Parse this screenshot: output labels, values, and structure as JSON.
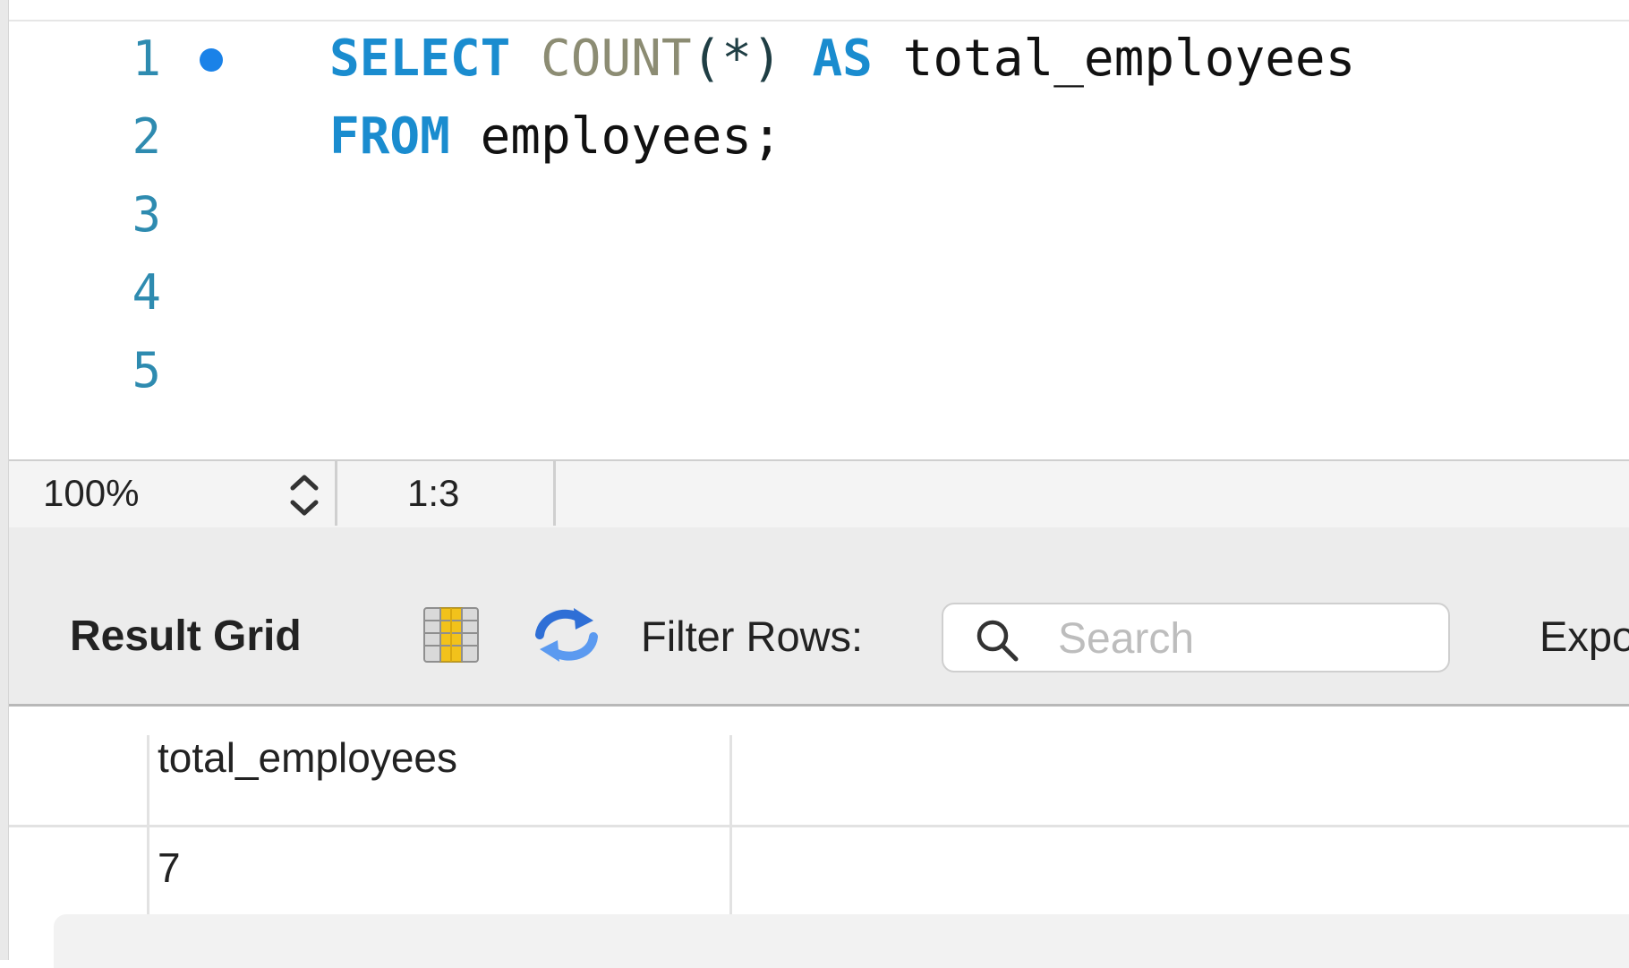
{
  "editor": {
    "lines": [
      {
        "number": "1",
        "has_breakpoint": true
      },
      {
        "number": "2",
        "has_breakpoint": false
      },
      {
        "number": "3",
        "has_breakpoint": false
      },
      {
        "number": "4",
        "has_breakpoint": false
      },
      {
        "number": "5",
        "has_breakpoint": false
      }
    ],
    "tokens": {
      "select": "SELECT",
      "count": "COUNT",
      "count_args": "(*)",
      "as": "AS",
      "alias": "total_employees",
      "from": "FROM",
      "table": "employees;"
    },
    "colors": {
      "keyword": "#1a8ccf",
      "function": "#8c8c73",
      "line_number": "#2e8bb0",
      "breakpoint": "#1a82e8"
    }
  },
  "status_bar": {
    "zoom": "100%",
    "cursor_position": "1:3"
  },
  "toolbar": {
    "result_grid_label": "Result Grid",
    "grid_icon": "column-grid-icon",
    "refresh_icon": "refresh-icon",
    "filter_label": "Filter Rows:",
    "search_placeholder": "Search",
    "export_label": "Expo"
  },
  "result_grid": {
    "columns": [
      "total_employees"
    ],
    "rows": [
      [
        "7"
      ]
    ]
  }
}
